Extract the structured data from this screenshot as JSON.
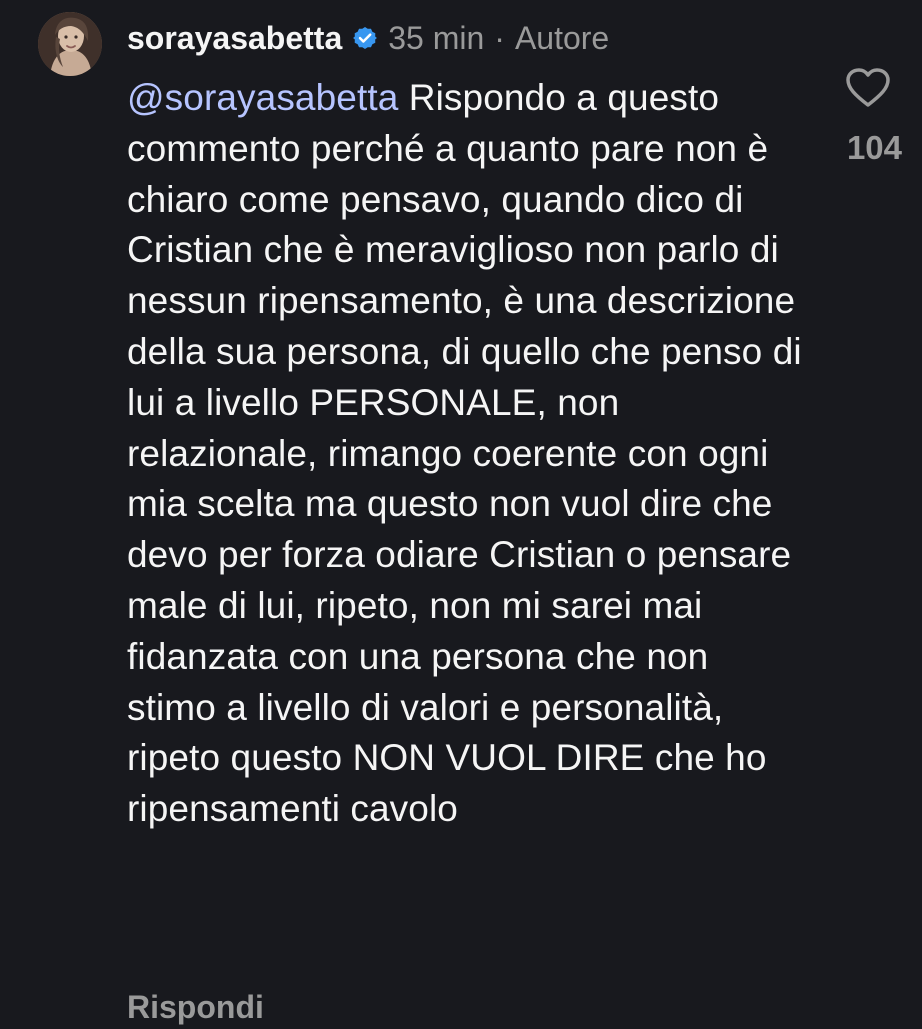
{
  "comment": {
    "username": "sorayasabetta",
    "verified_icon": "verified-badge-icon",
    "time": "35 min",
    "separator": "·",
    "role": "Autore",
    "mention": "@sorayasabetta",
    "text": " Rispondo a questo commento perché a quanto pare non è chiaro come pensavo, quando dico di Cristian che è meraviglioso non parlo di nessun ripensamento, è una descrizione della sua persona, di quello che penso di lui a livello PERSONALE, non relazionale, rimango coerente con ogni mia scelta ma questo non vuol dire che devo per forza odiare Cristian o pensare male di lui, ripeto, non mi sarei mai fidanzata con una persona che non stimo a livello di valori e personalità, ripeto questo NON VUOL DIRE che ho ripensamenti cavolo",
    "likes": "104",
    "like_icon": "heart-icon",
    "reply_label": "Rispondi"
  },
  "colors": {
    "background": "#18191e",
    "text": "#f5f5f5",
    "muted": "#9a9a9a",
    "mention": "#b6c4ff",
    "verified": "#3897f0"
  }
}
